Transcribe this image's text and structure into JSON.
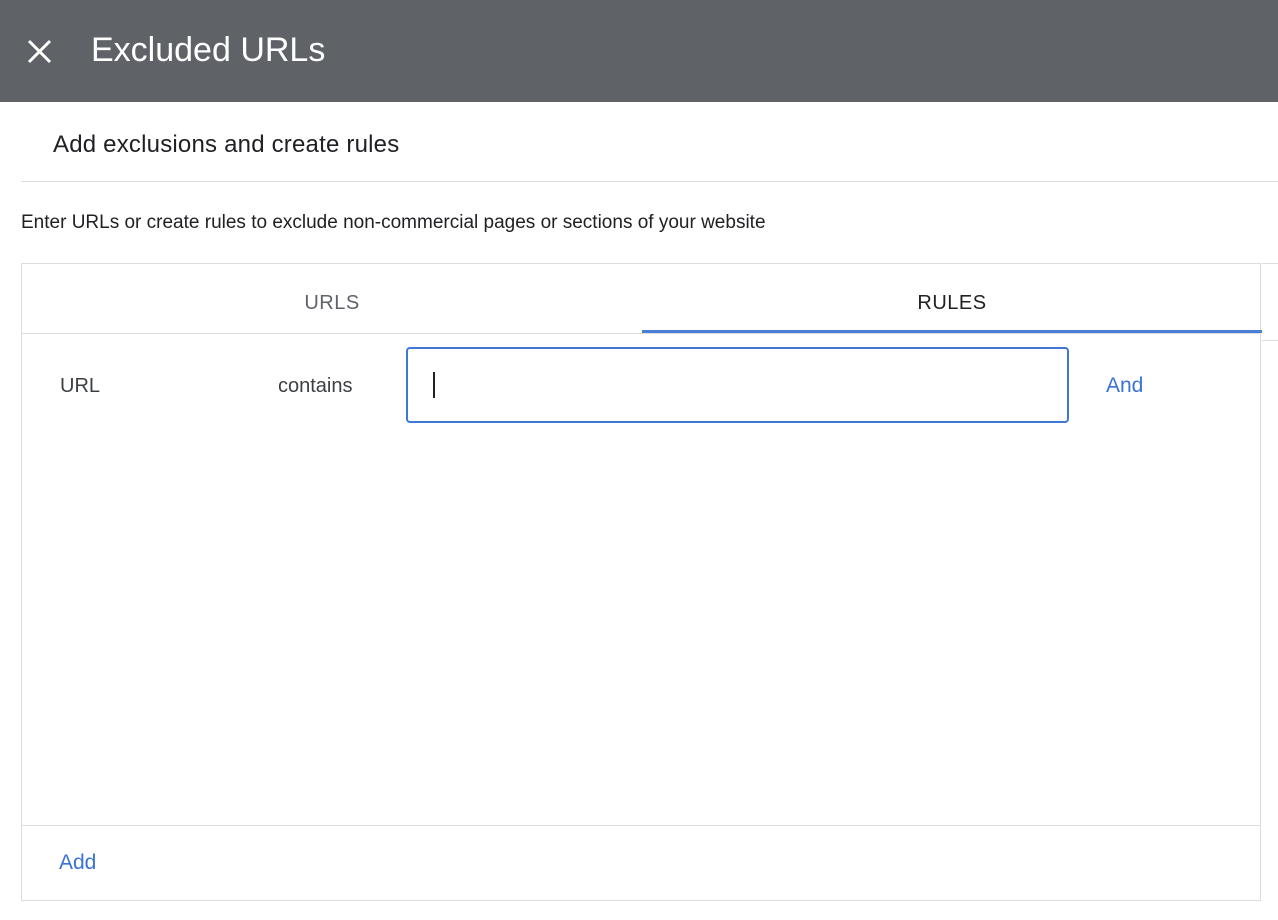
{
  "header": {
    "close_icon": "close-icon",
    "title": "Excluded URLs",
    "background_color": "#5f6368"
  },
  "section": {
    "title": "Add exclusions and create rules",
    "description": "Enter URLs or create rules to exclude non-commercial pages or sections of your website"
  },
  "tabs": [
    {
      "label": "URLS",
      "active": false
    },
    {
      "label": "RULES",
      "active": true
    }
  ],
  "rule": {
    "field": "URL",
    "operator": "contains",
    "value": "",
    "and_label": "And"
  },
  "footer": {
    "add_label": "Add"
  },
  "colors": {
    "accent": "#3a72d6",
    "tab_indicator": "#4a7fd8"
  }
}
